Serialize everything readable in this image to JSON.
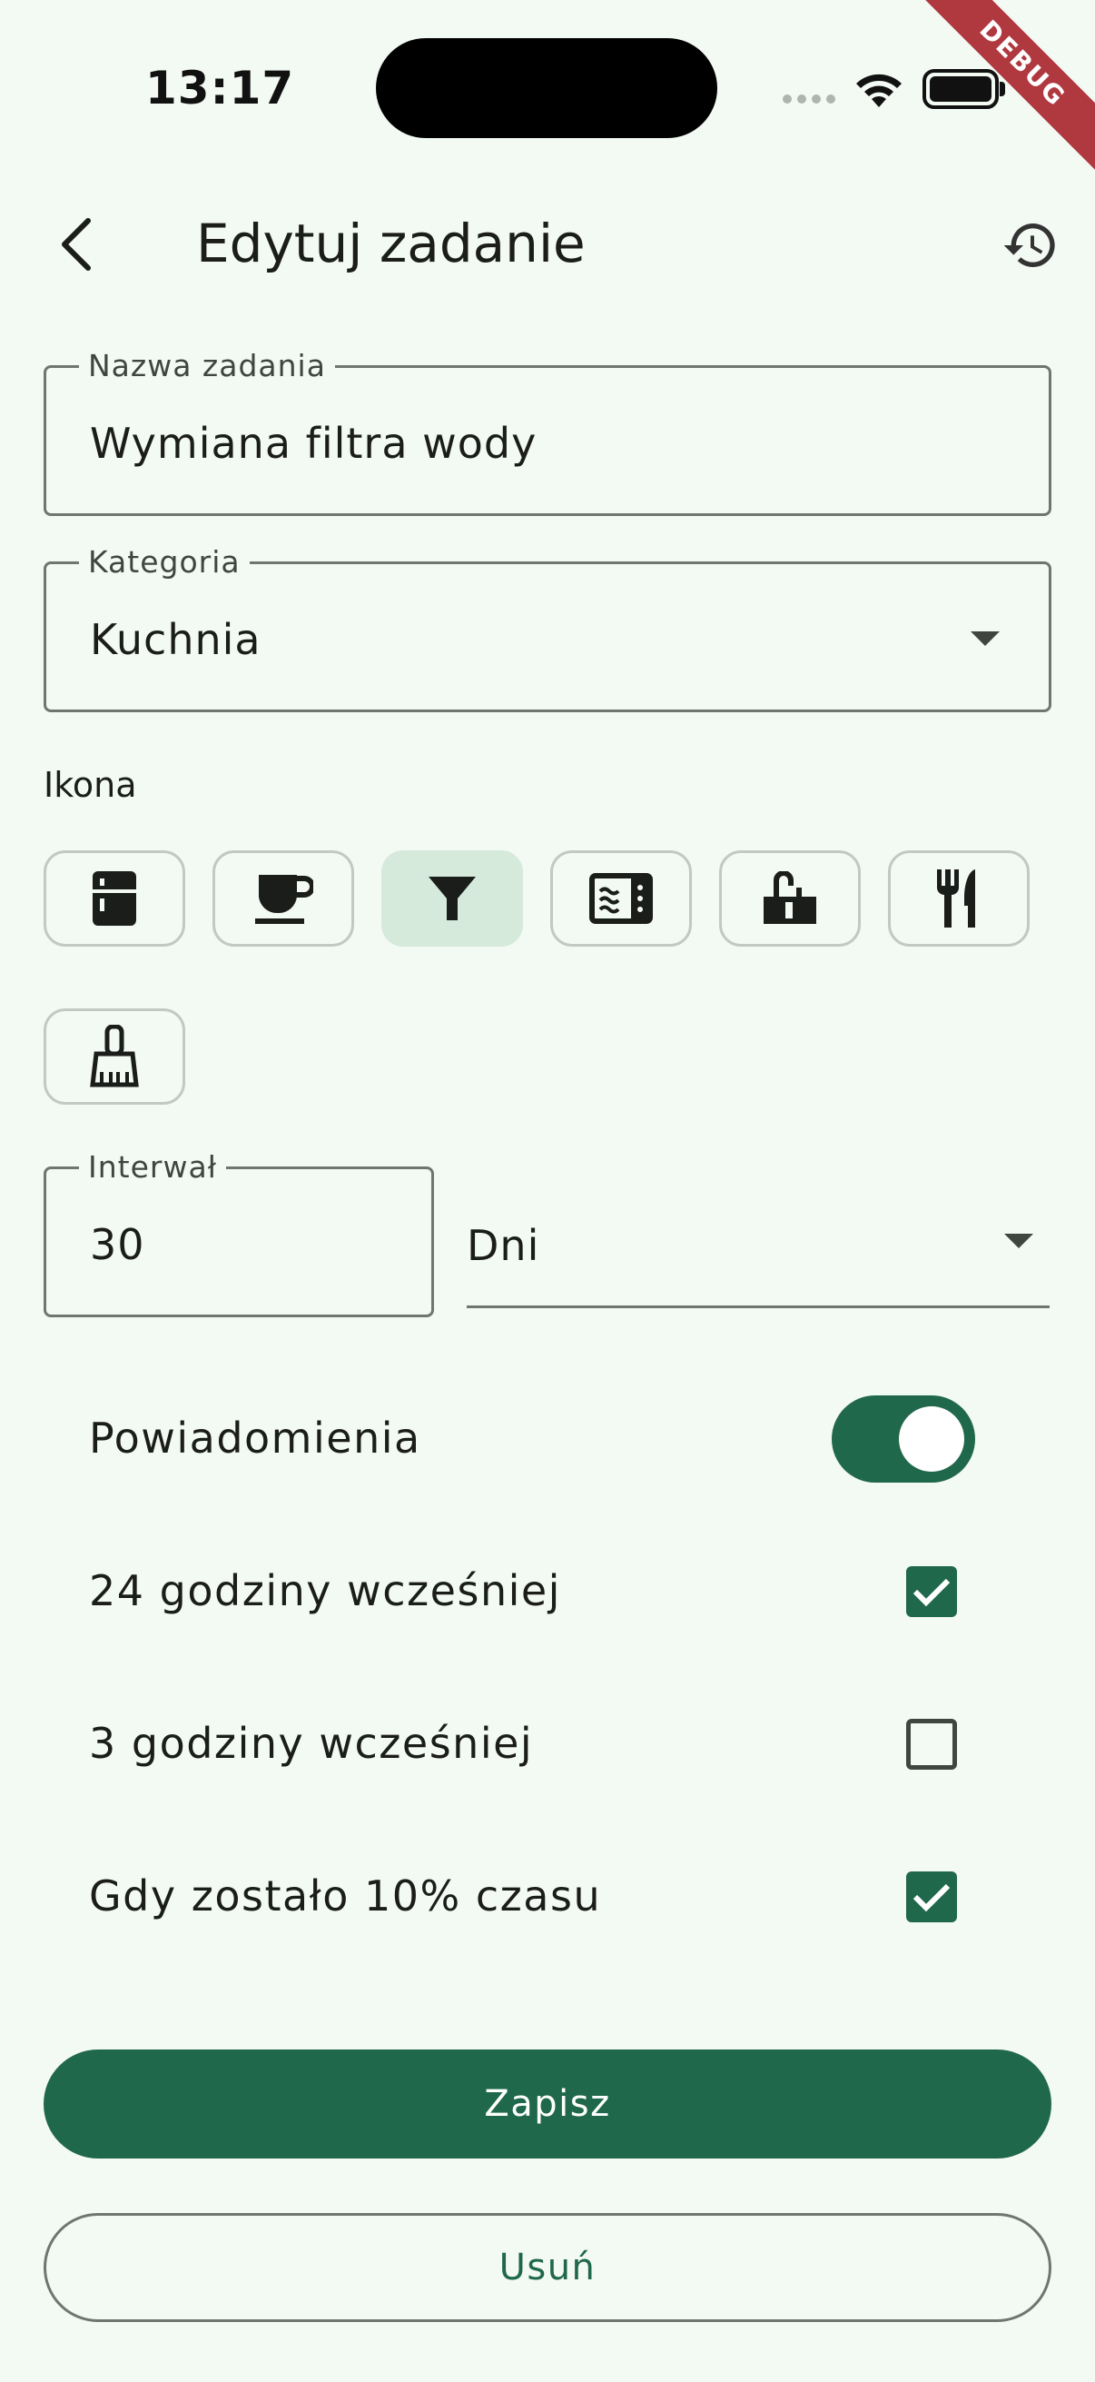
{
  "status_bar": {
    "time": "13:17",
    "debug_banner": "DEBUG"
  },
  "app_bar": {
    "title": "Edytuj zadanie",
    "back_icon": "arrow-back-icon",
    "history_icon": "history-icon"
  },
  "form": {
    "task_name": {
      "label": "Nazwa zadania",
      "value": "Wymiana filtra wody"
    },
    "category": {
      "label": "Kategoria",
      "value": "Kuchnia"
    },
    "icon_section": {
      "label": "Ikona",
      "icons": [
        {
          "name": "fridge-icon",
          "selected": false
        },
        {
          "name": "coffee-cup-icon",
          "selected": false
        },
        {
          "name": "filter-icon",
          "selected": true
        },
        {
          "name": "microwave-icon",
          "selected": false
        },
        {
          "name": "kitchen-sink-icon",
          "selected": false
        },
        {
          "name": "restaurant-cutlery-icon",
          "selected": false
        },
        {
          "name": "cleaning-brush-icon",
          "selected": false
        }
      ]
    },
    "interval": {
      "label": "Interwał",
      "value": "30",
      "unit": "Dni"
    }
  },
  "notifications": {
    "label": "Powiadomienia",
    "enabled": true,
    "options": [
      {
        "label": "24 godziny wcześniej",
        "checked": true
      },
      {
        "label": "3 godziny wcześniej",
        "checked": false
      },
      {
        "label": "Gdy zostało 10% czasu",
        "checked": true
      }
    ]
  },
  "buttons": {
    "save": "Zapisz",
    "delete": "Usuń"
  },
  "colors": {
    "primary": "#20684b",
    "background": "#f3f9f3",
    "selected_icon_bg": "#d6eadc",
    "debug": "#b0383f"
  }
}
